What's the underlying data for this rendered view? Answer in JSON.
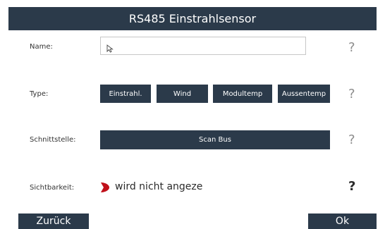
{
  "header": {
    "title": "RS485 Einstrahlsensor"
  },
  "form": {
    "name": {
      "label": "Name:",
      "value": ""
    },
    "type": {
      "label": "Type:",
      "options": [
        "Einstrahl.",
        "Wind",
        "Modultemp",
        "Aussentemp"
      ]
    },
    "interface": {
      "label": "Schnittstelle:",
      "button": "Scan Bus"
    },
    "visibility": {
      "label": "Sichtbarkeit:",
      "value": "wird nicht angeze"
    }
  },
  "help_symbol": "?",
  "footer": {
    "back_label": "Zurück",
    "ok_label": "Ok"
  },
  "colors": {
    "header_bg": "#2b3a4a",
    "button_bg": "#2b3a4a",
    "visibility_icon": "#c0101a",
    "help_gray": "#8c8c8c"
  }
}
